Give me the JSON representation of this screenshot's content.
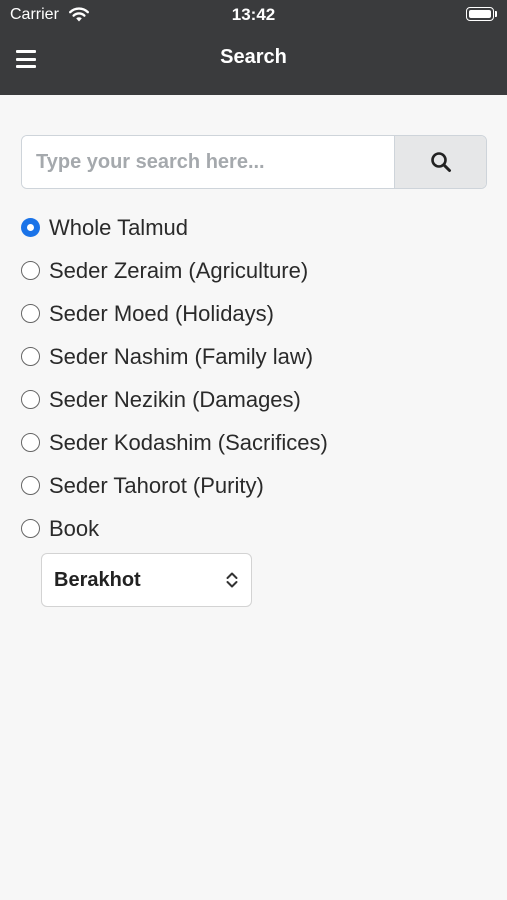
{
  "status_bar": {
    "carrier": "Carrier",
    "time": "13:42",
    "icons": [
      "wifi-icon",
      "battery-icon"
    ]
  },
  "header": {
    "title": "Search",
    "menu_icon": "hamburger-menu-icon"
  },
  "search": {
    "value": "",
    "placeholder": "Type your search here...",
    "button_icon": "search-icon"
  },
  "scopes": [
    {
      "label": "Whole Talmud",
      "checked": true
    },
    {
      "label": "Seder Zeraim (Agriculture)",
      "checked": false
    },
    {
      "label": "Seder Moed (Holidays)",
      "checked": false
    },
    {
      "label": "Seder Nashim (Family law)",
      "checked": false
    },
    {
      "label": "Seder Nezikin (Damages)",
      "checked": false
    },
    {
      "label": "Seder Kodashim (Sacrifices)",
      "checked": false
    },
    {
      "label": "Seder Tahorot (Purity)",
      "checked": false
    },
    {
      "label": "Book",
      "checked": false
    }
  ],
  "book_select": {
    "selected": "Berakhot",
    "icon": "chevron-up-down-icon"
  },
  "colors": {
    "header_bg": "#3a3b3d",
    "accent": "#1a73e8",
    "page_bg": "#f7f7f7"
  }
}
